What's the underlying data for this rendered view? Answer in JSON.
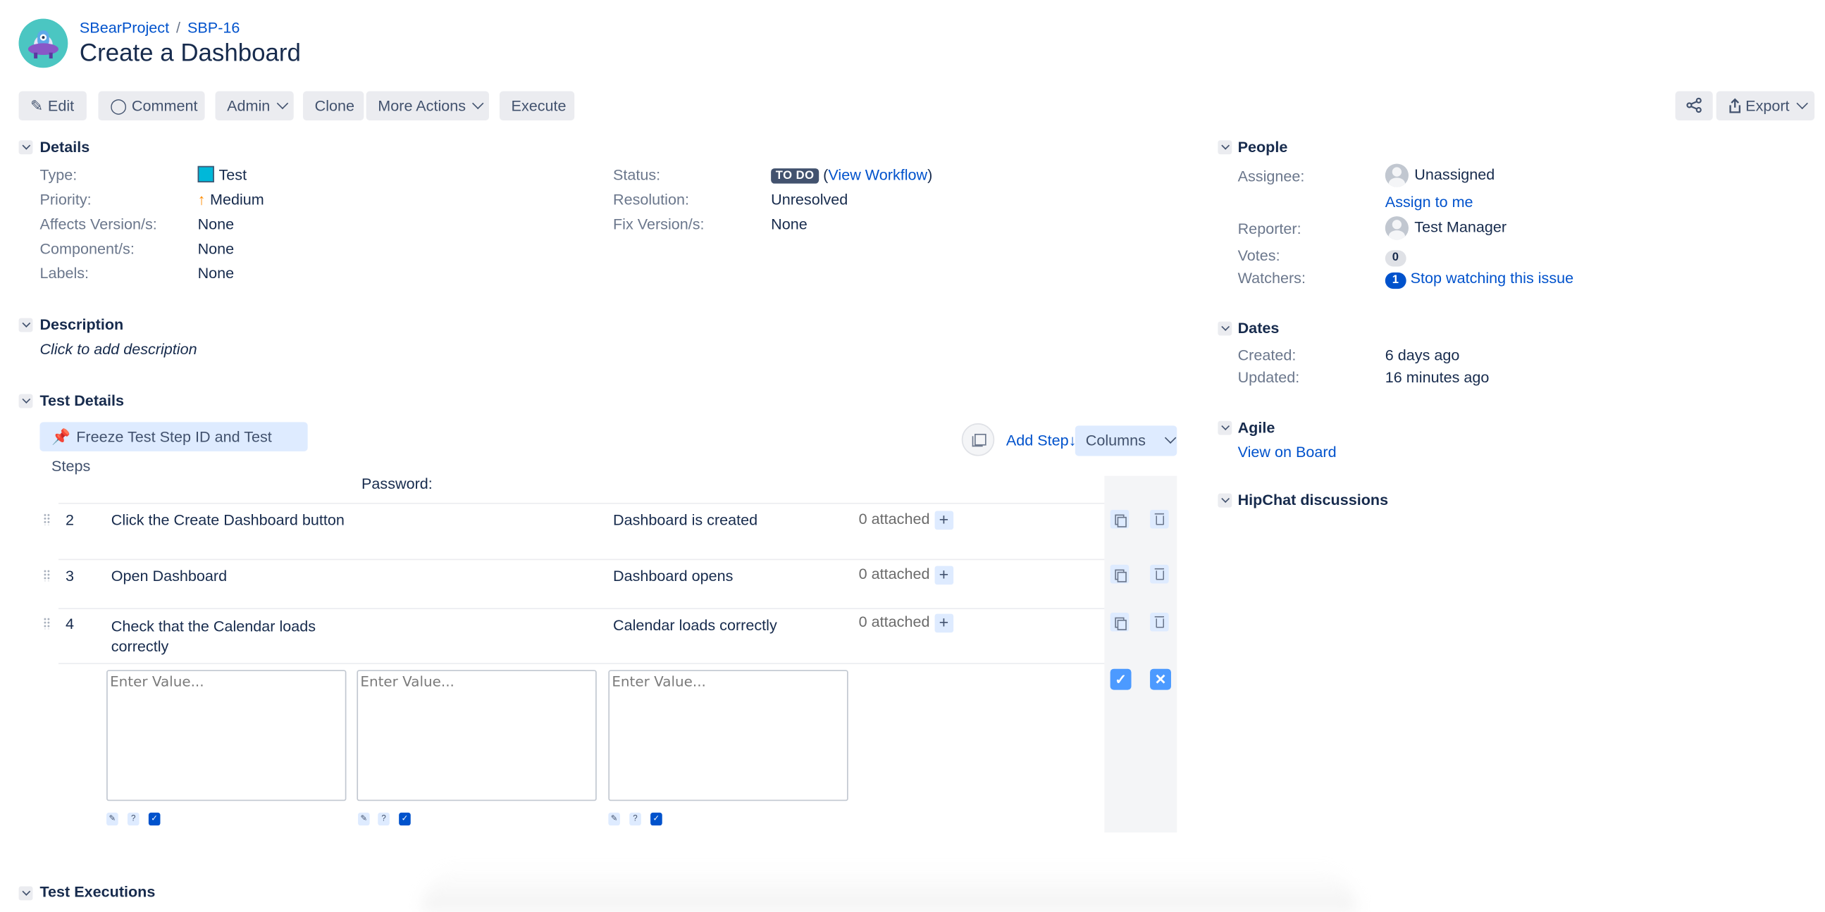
{
  "header": {
    "project_name": "SBearProject",
    "breadcrumb_separator": "/",
    "issue_key": "SBP-16",
    "title": "Create a Dashboard"
  },
  "toolbar": {
    "edit": "Edit",
    "comment": "Comment",
    "admin": "Admin",
    "clone": "Clone",
    "more_actions": "More Actions",
    "execute": "Execute",
    "export": "Export"
  },
  "details": {
    "heading": "Details",
    "left": [
      {
        "label": "Type:",
        "value": "Test"
      },
      {
        "label": "Priority:",
        "value": "Medium"
      },
      {
        "label": "Affects Version/s:",
        "value": "None"
      },
      {
        "label": "Component/s:",
        "value": "None"
      },
      {
        "label": "Labels:",
        "value": "None"
      }
    ],
    "right": [
      {
        "label": "Status:",
        "value": "TO DO",
        "link": "View Workflow"
      },
      {
        "label": "Resolution:",
        "value": "Unresolved"
      },
      {
        "label": "Fix Version/s:",
        "value": "None"
      }
    ]
  },
  "description": {
    "heading": "Description",
    "placeholder": "Click to add description"
  },
  "test_details": {
    "heading": "Test Details",
    "freeze_button": "Freeze Test Step ID and Test Steps",
    "add_step": "Add Step↓",
    "columns": "Columns",
    "partial_header": "Password:",
    "steps": [
      {
        "num": "2",
        "step": "Click the Create Dashboard button",
        "result": "Dashboard is created",
        "attachments": "0 attached"
      },
      {
        "num": "3",
        "step": "Open Dashboard",
        "result": "Dashboard opens",
        "attachments": "0 attached"
      },
      {
        "num": "4",
        "step": "Check that the Calendar loads correctly",
        "result": "Calendar loads correctly",
        "attachments": "0 attached"
      }
    ],
    "new_step": {
      "placeholder": "Enter Value...",
      "mini_help": "?"
    }
  },
  "test_executions": {
    "heading": "Test Executions"
  },
  "people": {
    "heading": "People",
    "assignee_label": "Assignee:",
    "assignee": "Unassigned",
    "assign_to_me": "Assign to me",
    "reporter_label": "Reporter:",
    "reporter": "Test Manager",
    "votes_label": "Votes:",
    "votes": "0",
    "watchers_label": "Watchers:",
    "watchers": "1",
    "stop_watching": "Stop watching this issue"
  },
  "dates": {
    "heading": "Dates",
    "created_label": "Created:",
    "created": "6 days ago",
    "updated_label": "Updated:",
    "updated": "16 minutes ago"
  },
  "agile": {
    "heading": "Agile",
    "view_on_board": "View on Board"
  },
  "hipchat": {
    "heading": "HipChat discussions"
  },
  "colors": {
    "link": "#0052cc",
    "text": "#172b4d",
    "label": "#6b778c",
    "button_bg": "#ebecf0",
    "selected_bg": "#deebff",
    "status_todo": "#42526e",
    "confirm": "#4c9aff",
    "priority_medium": "#ff8b00"
  }
}
